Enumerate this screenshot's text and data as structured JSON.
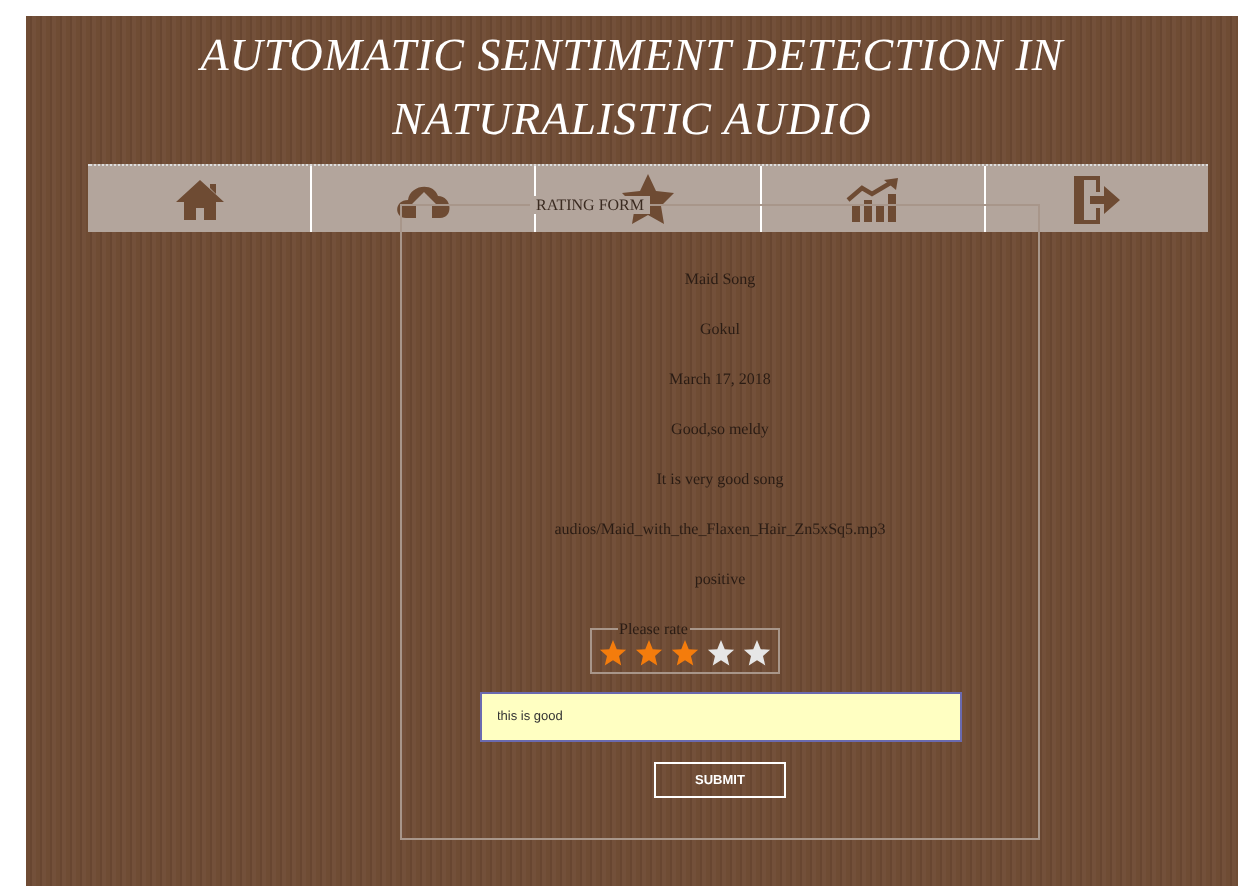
{
  "header": {
    "title_lines": [
      "AUTOMATIC SENTIMENT DETECTION IN",
      "NATURALISTIC AUDIO"
    ]
  },
  "nav": {
    "items": [
      {
        "kind": "home"
      },
      {
        "kind": "upload"
      },
      {
        "kind": "star"
      },
      {
        "kind": "chart"
      },
      {
        "kind": "exit"
      }
    ]
  },
  "form": {
    "legend": "RATING FORM",
    "details": [
      "Maid Song",
      "Gokul",
      "March 17, 2018",
      "Good,so meldy",
      "It is very good song",
      "audios/Maid_with_the_Flaxen_Hair_Zn5xSq5.mp3",
      "positive"
    ],
    "rating": {
      "legend": "Please rate",
      "stars": 3
    },
    "comment": {
      "value": "this is good"
    },
    "submit": "SUBMIT"
  }
}
